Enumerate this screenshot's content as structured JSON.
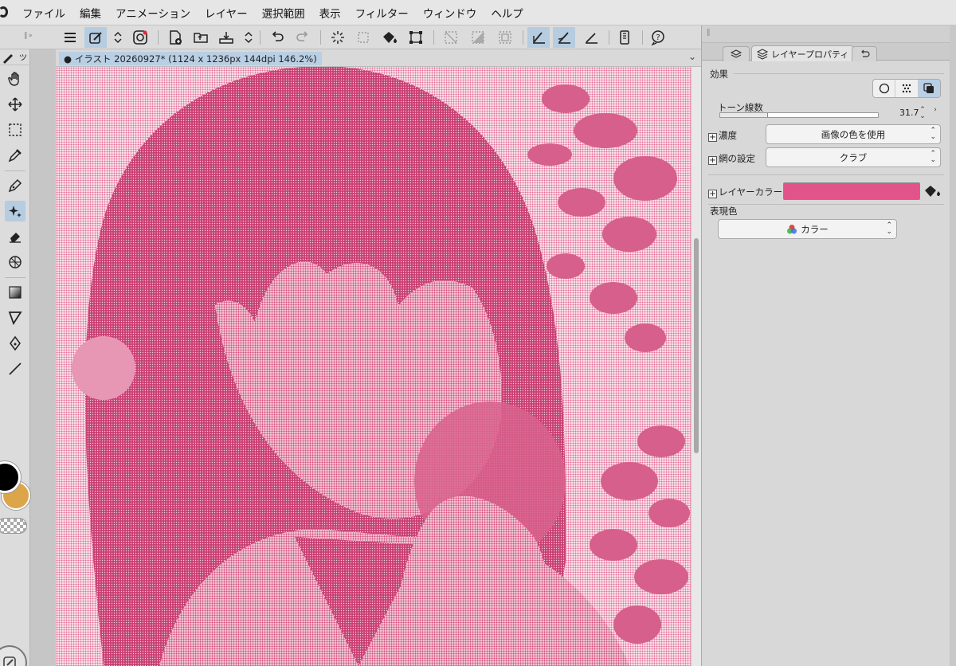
{
  "menu": [
    "ファイル",
    "編集",
    "アニメーション",
    "レイヤー",
    "選択範囲",
    "表示",
    "フィルター",
    "ウィンドウ",
    "ヘルプ"
  ],
  "left_panel_tab": "ツ",
  "document": {
    "title": "イラスト 20260927* (1124 x 1236px 144dpi 146.2%)"
  },
  "panel": {
    "tab_active_label": "レイヤープロパティ",
    "effect_label": "効果",
    "tone_lines_label": "トーン線数",
    "tone_lines_value": "31.7",
    "density_label": "濃度",
    "density_value": "画像の色を使用",
    "screen_label": "網の設定",
    "screen_value": "クラブ",
    "layer_color_label": "レイヤーカラー",
    "layer_color": "#e0548a",
    "expression_label": "表現色",
    "expression_value": "カラー"
  },
  "colors": {
    "main": "#000000",
    "sub": "#dca54a",
    "tone": "#e26e96"
  }
}
